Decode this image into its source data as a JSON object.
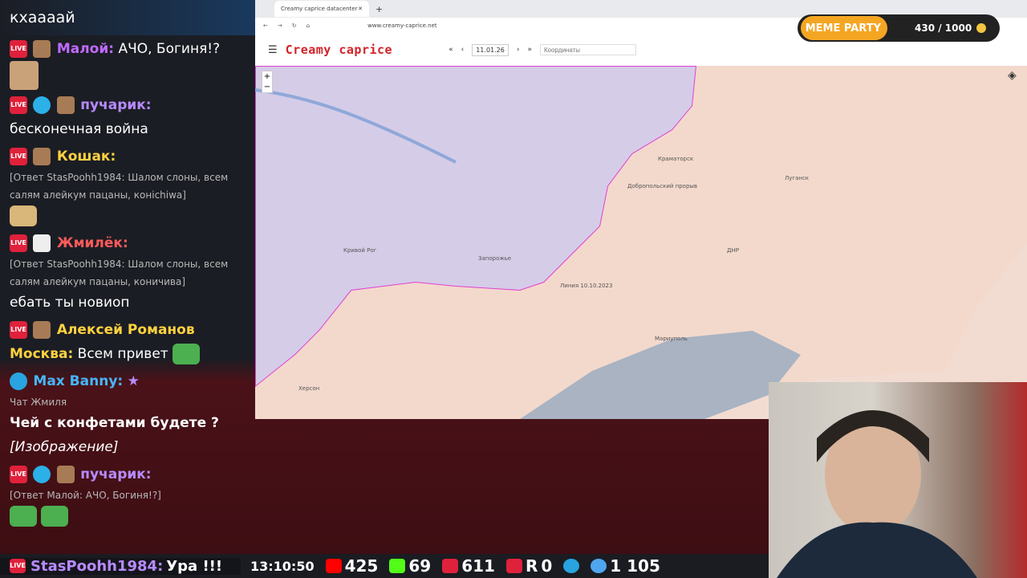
{
  "chat": {
    "top_user": "кхаааай",
    "messages": [
      {
        "name": "Малой:",
        "text": "АЧО, Богиня!?",
        "color": "#c06bff"
      },
      {
        "name": "пучарик:",
        "text": "бесконечная война",
        "color": "#b78bff"
      },
      {
        "name": "Кошак:",
        "reply": "[Ответ StasPoohh1984: Шалом слоны, всем салям алейкум пацаны, конichiwa]",
        "color": "#ffd23f"
      },
      {
        "name": "Жмилёк:",
        "reply": "[Ответ StasPoohh1984: Шалом слоны, всем салям алейкум пацаны, коничива]",
        "text": "ебать ты новиоп",
        "color": "#ff5a5a"
      },
      {
        "name": "Алексей Романов Москва:",
        "text": "Всем привет",
        "color": "#ffd23f"
      },
      {
        "name": "Max Banny:",
        "sub": "Чат Жмиля",
        "text": "Чей с конфетами будете ?",
        "extra": "[Изображение]",
        "color": "#44b8ff"
      },
      {
        "name": "пучарик:",
        "reply": "[Ответ Малой: АЧО, Богиня!?]",
        "color": "#b78bff"
      }
    ]
  },
  "browser": {
    "tab_title": "Creamy caprice datacenter",
    "url": "www.creamy-caprice.net",
    "brand": "Creamy caprice",
    "date": "11.01.26",
    "coords_placeholder": "Координаты"
  },
  "map": {
    "labels": [
      "Кривой Рог",
      "Запорожье",
      "ДНР",
      "Мариуполь",
      "Херсон",
      "Линия 10.10.2023",
      "Добропольский прорыв",
      "Краматорск",
      "Луганск"
    ],
    "zoom_in": "+",
    "zoom_out": "−"
  },
  "meme": {
    "label": "MEME PARTY",
    "count": "430 / 1000"
  },
  "statusbar": {
    "user": "StasPoohh1984:",
    "user_text": "Ура !!!",
    "time": "13:10:50",
    "youtube": "425",
    "kick": "69",
    "vk": "611",
    "rutube": "0",
    "telegram": "",
    "viewers": "1 105"
  }
}
